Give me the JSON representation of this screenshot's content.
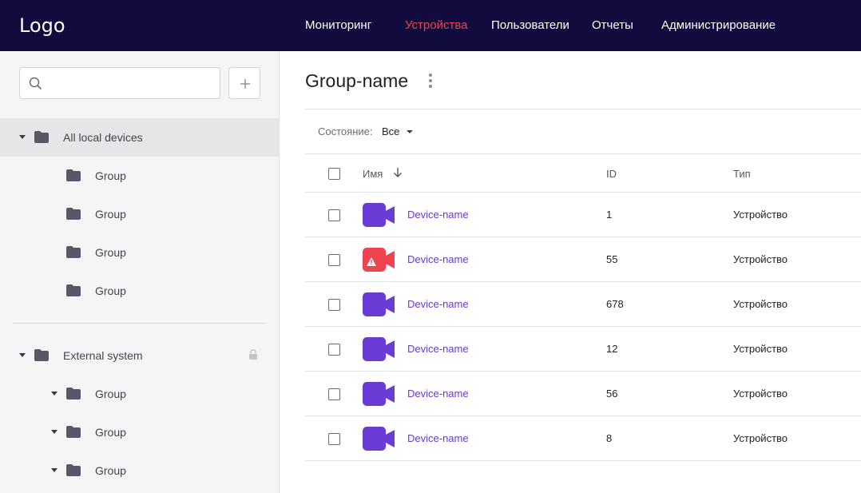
{
  "app": {
    "logo": "Logo"
  },
  "nav": [
    {
      "label": "Мониторинг",
      "active": false
    },
    {
      "label": "Устройства",
      "active": true
    },
    {
      "label": "Пользователи",
      "active": false
    },
    {
      "label": "Отчеты",
      "active": false
    },
    {
      "label": "Администрирование",
      "active": false
    }
  ],
  "sidebar": {
    "search": {
      "value": "",
      "placeholder": ""
    },
    "tree": [
      {
        "label": "All local devices",
        "expanded": true,
        "selected": true
      },
      {
        "label": "Group"
      },
      {
        "label": "Group"
      },
      {
        "label": "Group"
      },
      {
        "label": "Group"
      },
      {
        "label": "External system",
        "expanded": true,
        "locked": true
      },
      {
        "label": "Group",
        "expanded": true
      },
      {
        "label": "Group",
        "expanded": true
      },
      {
        "label": "Group",
        "expanded": true
      }
    ]
  },
  "main": {
    "title": "Group-name",
    "filter": {
      "label": "Состояние:",
      "value": "Все"
    },
    "columns": {
      "name": "Имя",
      "id": "ID",
      "type": "Тип"
    },
    "rows": [
      {
        "name": "Device-name",
        "id": "1",
        "type": "Устройство",
        "status": "ok"
      },
      {
        "name": "Device-name",
        "id": "55",
        "type": "Устройство",
        "status": "alert"
      },
      {
        "name": "Device-name",
        "id": "678",
        "type": "Устройство",
        "status": "ok"
      },
      {
        "name": "Device-name",
        "id": "12",
        "type": "Устройство",
        "status": "ok"
      },
      {
        "name": "Device-name",
        "id": "56",
        "type": "Устройство",
        "status": "ok"
      },
      {
        "name": "Device-name",
        "id": "8",
        "type": "Устройство",
        "status": "ok"
      }
    ]
  },
  "colors": {
    "topbar_bg": "#120b3d",
    "nav_active": "#f0434f",
    "device_ok": "#6b3bd6",
    "device_alert": "#f0434f",
    "link": "#6b3bd6"
  }
}
